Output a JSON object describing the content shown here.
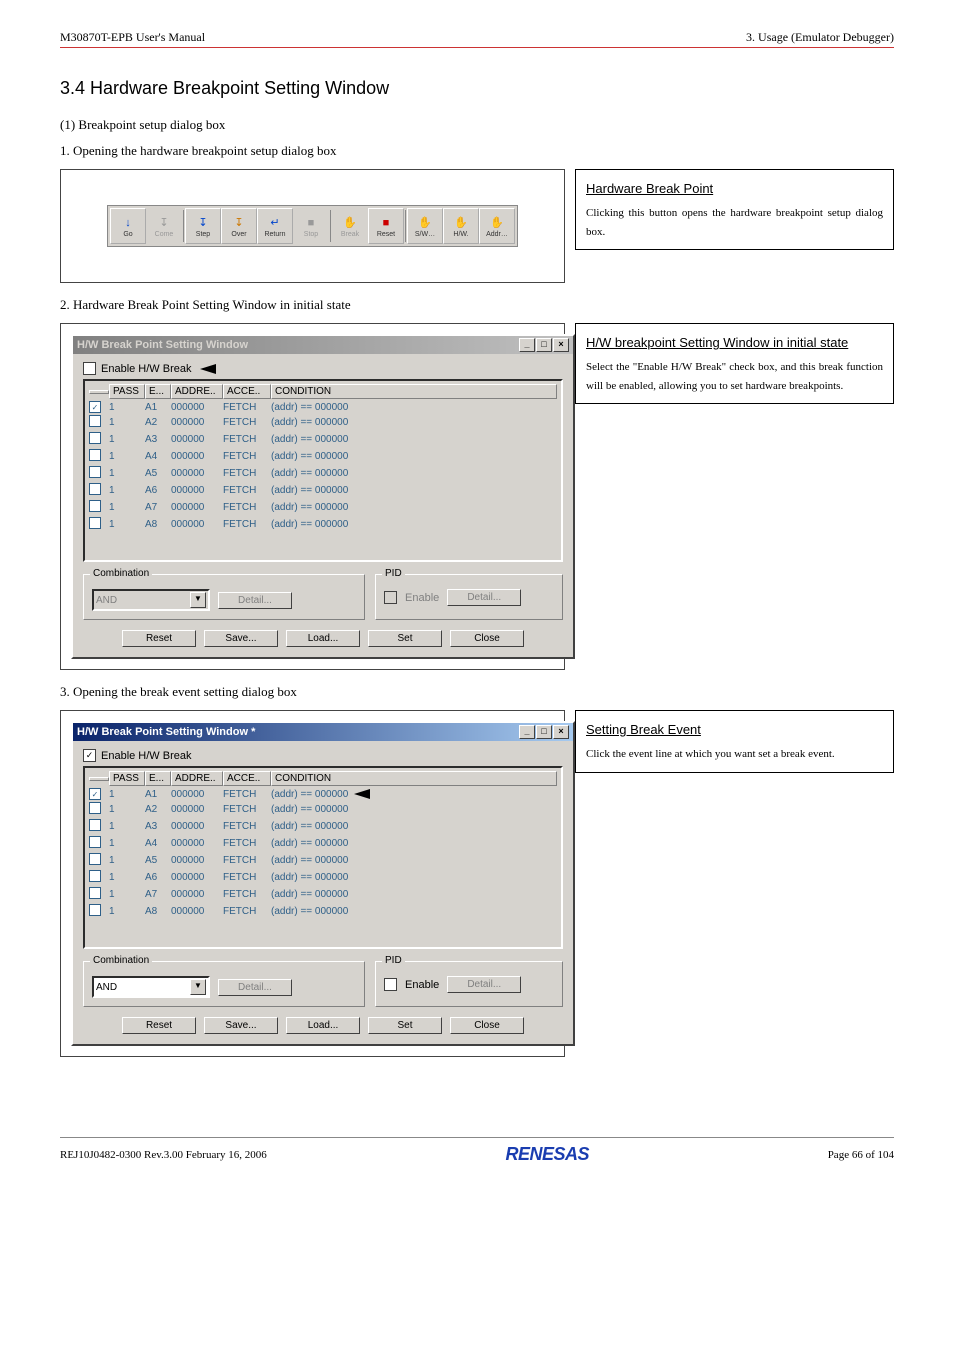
{
  "header": {
    "left": "M30870T-EPB User's Manual",
    "right": "3. Usage (Emulator Debugger)"
  },
  "section_title": "3.4 Hardware Breakpoint Setting Window",
  "sub1": "(1) Breakpoint setup dialog box",
  "cap1": "1. Opening the hardware breakpoint setup dialog box",
  "cap2": "2. Hardware Break Point Setting Window in initial state",
  "cap3": "3. Opening the break event setting dialog box",
  "note1": {
    "title": "Hardware Break Point",
    "body": "Clicking this button opens the hardware breakpoint setup dialog box."
  },
  "note2": {
    "title": "H/W breakpoint Setting Window in initial state",
    "body": "Select the \"Enable H/W Break\" check box, and this break function will be enabled, allowing you to set hardware breakpoints."
  },
  "note3": {
    "title": "Setting Break Event",
    "body": "Click the event line at which you want set a break event."
  },
  "toolbar": {
    "buttons": [
      {
        "label": "Go",
        "icon": "↓",
        "state": "enabled",
        "color": "#0044cc"
      },
      {
        "label": "Come",
        "icon": "↧",
        "state": "disabled",
        "color": "#999"
      },
      {
        "label": "Step",
        "icon": "↧",
        "state": "enabled",
        "color": "#0044cc"
      },
      {
        "label": "Over",
        "icon": "↧",
        "state": "enabled",
        "color": "#cc7700"
      },
      {
        "label": "Return",
        "icon": "↵",
        "state": "enabled",
        "color": "#0044cc"
      },
      {
        "label": "Stop",
        "icon": "■",
        "state": "disabled",
        "color": "#999"
      },
      {
        "label": "Break",
        "icon": "✋",
        "state": "disabled",
        "color": "#999"
      },
      {
        "label": "Reset",
        "icon": "■",
        "state": "enabled",
        "color": "#cc0000"
      },
      {
        "label": "S/W…",
        "icon": "✋",
        "state": "enabled",
        "color": "#338"
      },
      {
        "label": "H/W.",
        "icon": "✋",
        "state": "enabled",
        "color": "#338"
      },
      {
        "label": "Addr…",
        "icon": "✋",
        "state": "enabled",
        "color": "#338"
      }
    ]
  },
  "win": {
    "title_inactive": "H/W Break Point Setting Window",
    "title_active": "H/W Break Point Setting Window *",
    "enable_label": "Enable H/W Break",
    "headers": {
      "pass": "PASS",
      "e": "E...",
      "addr": "ADDRE..",
      "acc": "ACCE..",
      "cond": "CONDITION"
    },
    "rows": [
      {
        "chk": true,
        "pass": "1",
        "e": "A1",
        "addr": "000000",
        "acc": "FETCH",
        "cond": "(addr) == 000000"
      },
      {
        "chk": false,
        "pass": "1",
        "e": "A2",
        "addr": "000000",
        "acc": "FETCH",
        "cond": "(addr) == 000000"
      },
      {
        "chk": false,
        "pass": "1",
        "e": "A3",
        "addr": "000000",
        "acc": "FETCH",
        "cond": "(addr) == 000000"
      },
      {
        "chk": false,
        "pass": "1",
        "e": "A4",
        "addr": "000000",
        "acc": "FETCH",
        "cond": "(addr) == 000000"
      },
      {
        "chk": false,
        "pass": "1",
        "e": "A5",
        "addr": "000000",
        "acc": "FETCH",
        "cond": "(addr) == 000000"
      },
      {
        "chk": false,
        "pass": "1",
        "e": "A6",
        "addr": "000000",
        "acc": "FETCH",
        "cond": "(addr) == 000000"
      },
      {
        "chk": false,
        "pass": "1",
        "e": "A7",
        "addr": "000000",
        "acc": "FETCH",
        "cond": "(addr) == 000000"
      },
      {
        "chk": false,
        "pass": "1",
        "e": "A8",
        "addr": "000000",
        "acc": "FETCH",
        "cond": "(addr) == 000000"
      }
    ],
    "combination": "Combination",
    "combo_value": "AND",
    "detail": "Detail...",
    "pid": "PID",
    "pid_enable": "Enable",
    "buttons": {
      "reset": "Reset",
      "save": "Save...",
      "load": "Load...",
      "set": "Set",
      "close": "Close"
    }
  },
  "footer": {
    "left": "REJ10J0482-0300   Rev.3.00   February 16, 2006",
    "brand": "RENESAS",
    "right": "Page 66 of 104"
  }
}
